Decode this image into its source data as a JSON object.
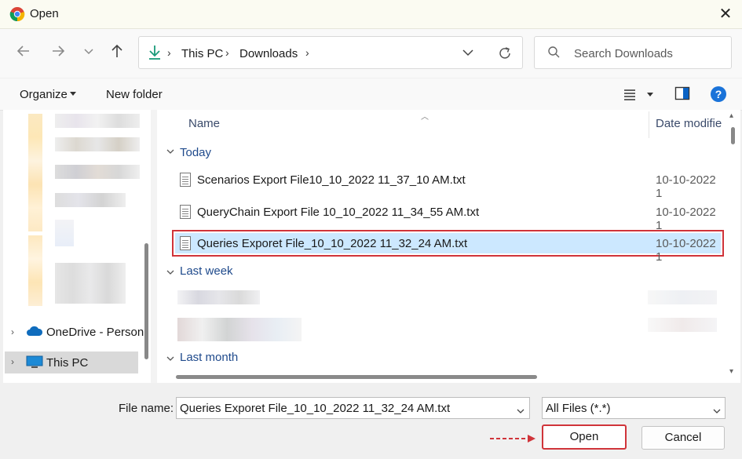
{
  "window": {
    "title": "Open",
    "close_label": "✕",
    "icon": "chrome-icon"
  },
  "nav": {
    "path": [
      "This PC",
      "Downloads"
    ],
    "search_placeholder": "Search Downloads"
  },
  "toolbar": {
    "organize_label": "Organize",
    "new_folder_label": "New folder"
  },
  "sidebar": {
    "items": [
      {
        "label": "OneDrive - Person",
        "icon": "onedrive-cloud-icon"
      },
      {
        "label": "This PC",
        "icon": "monitor-icon",
        "selected": true
      }
    ]
  },
  "columns": {
    "name": "Name",
    "date": "Date modifie"
  },
  "groups": {
    "today": {
      "label": "Today",
      "files": [
        {
          "name": "Scenarios Export File10_10_2022 11_37_10 AM.txt",
          "date": "10-10-2022 1"
        },
        {
          "name": "QueryChain Export File 10_10_2022 11_34_55 AM.txt",
          "date": "10-10-2022 1"
        },
        {
          "name": "Queries Exporet File_10_10_2022 11_32_24 AM.txt",
          "date": "10-10-2022 1",
          "selected": true
        }
      ]
    },
    "last_week": {
      "label": "Last week"
    },
    "last_month": {
      "label": "Last month"
    }
  },
  "footer": {
    "file_name_label": "File name:",
    "file_name_value": "Queries Exporet File_10_10_2022 11_32_24 AM.txt",
    "filter_value": "All Files (*.*)",
    "open_label": "Open",
    "cancel_label": "Cancel"
  },
  "colors": {
    "highlight_border": "#d0343a",
    "selection_bg": "#cce8ff",
    "accent": "#0067c0"
  }
}
